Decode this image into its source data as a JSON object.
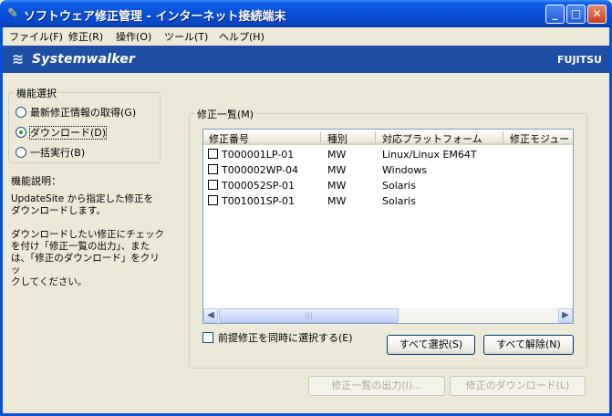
{
  "window": {
    "title": "ソフトウェア修正管理 - インターネット接続端末",
    "minimize_label": "_",
    "maximize_label": "□",
    "close_label": "✕"
  },
  "menu": [
    "ファイル(F)",
    "修正(R)",
    "操作(O)",
    "ツール(T)",
    "ヘルプ(H)"
  ],
  "banner": {
    "product": "Systemwalker",
    "vendor": "FUJITSU"
  },
  "function_select": {
    "legend": "機能選択",
    "options": [
      {
        "label": "最新修正情報の取得(G)",
        "selected": false
      },
      {
        "label": "ダウンロード(D)",
        "selected": true
      },
      {
        "label": "一括実行(B)",
        "selected": false
      }
    ]
  },
  "description": {
    "label": "機能説明：",
    "text": "UpdateSite から指定した修正を\nダウンロードします。\n\nダウンロードしたい修正にチェック\nを付け「修正一覧の出力」、また\nは、「修正のダウンロード」をクリッ\nクしてください。"
  },
  "fix_list": {
    "legend": "修正一覧(M)",
    "columns": [
      "修正番号",
      "種別",
      "対応プラットフォーム",
      "修正モジュー"
    ],
    "rows": [
      {
        "id": "T000001LP-01",
        "type": "MW",
        "platform": "Linux/Linux EM64T",
        "checked": false
      },
      {
        "id": "T000002WP-04",
        "type": "MW",
        "platform": "Windows",
        "checked": false
      },
      {
        "id": "T000052SP-01",
        "type": "MW",
        "platform": "Solaris",
        "checked": false
      },
      {
        "id": "T001001SP-01",
        "type": "MW",
        "platform": "Solaris",
        "checked": false
      }
    ],
    "scroll_left": "◀",
    "scroll_right": "▶",
    "scroll_grip": "|||"
  },
  "prereq_checkbox": {
    "label": "前提修正を同時に選択する(E)",
    "checked": false
  },
  "buttons": {
    "select_all": "すべて選択(S)",
    "clear_all": "すべて解除(N)",
    "export_list": "修正一覧の出力(I)...",
    "download": "修正のダウンロード(L)"
  }
}
